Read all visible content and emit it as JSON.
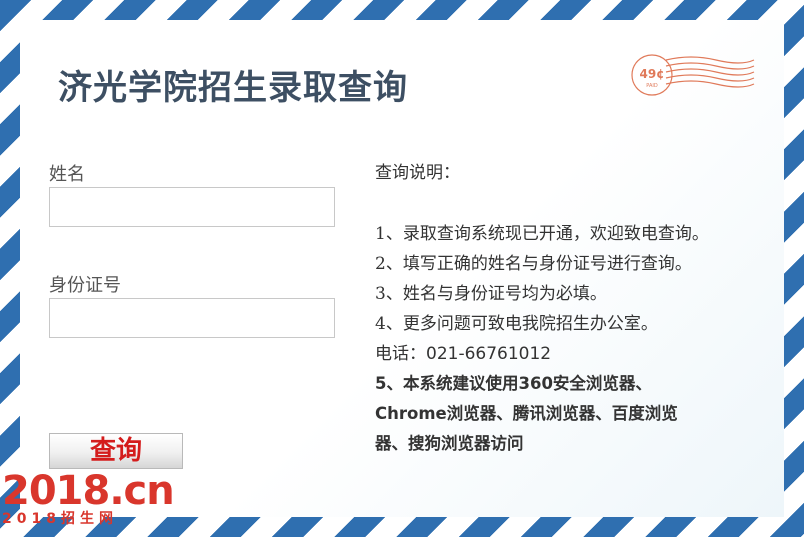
{
  "header": {
    "title": "济光学院招生录取查询"
  },
  "stamp": {
    "value": "49¢",
    "sub": "PAID"
  },
  "form": {
    "name_label": "姓名",
    "name_value": "",
    "id_label": "身份证号",
    "id_value": "",
    "submit_label": "查询"
  },
  "info": {
    "heading": "查询说明：",
    "items": [
      "1、录取查询系统现已开通，欢迎致电查询。",
      "2、填写正确的姓名与身份证号进行查询。",
      "3、姓名与身份证号均为必填。",
      "4、更多问题可致电我院招生办公室。"
    ],
    "phone_label": "电话：",
    "phone_number": "021-66761012",
    "browser_note_lines": [
      "5、本系统建议使用360安全浏览器、",
      "Chrome浏览器、腾讯浏览器、百度浏览",
      "器、搜狗浏览器访问"
    ]
  },
  "watermark": {
    "main": "2018.cn",
    "sub": "2018招生网"
  },
  "colors": {
    "stripe": "#2f6fb0",
    "title": "#3d4f63",
    "button_text": "#d41c1c",
    "watermark": "#d9362c"
  }
}
